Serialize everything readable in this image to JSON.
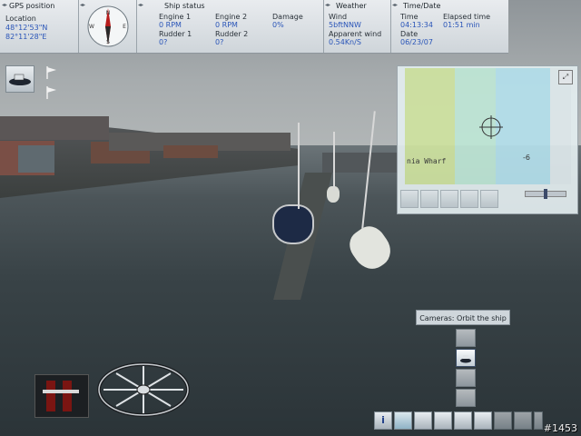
{
  "gps": {
    "title": "GPS position",
    "location_label": "Location",
    "lat": "48°12'53\"N",
    "lon": "82°11'28\"E"
  },
  "ship_status": {
    "title": "Ship status",
    "engine1_label": "Engine 1",
    "engine1_value": "0 RPM",
    "engine2_label": "Engine 2",
    "engine2_value": "0 RPM",
    "damage_label": "Damage",
    "damage_value": "0%",
    "rudder1_label": "Rudder 1",
    "rudder1_value": "0?",
    "rudder2_label": "Rudder 2",
    "rudder2_value": "0?"
  },
  "weather": {
    "title": "Weather",
    "wind_label": "Wind",
    "wind_value": "5bftNNW",
    "apparent_label": "Apparent wind",
    "apparent_value": "0.54Kn/S"
  },
  "timedate": {
    "title": "Time/Date",
    "time_label": "Time",
    "time_value": "04:13:34",
    "elapsed_label": "Elapsed time",
    "elapsed_value": "01:51 min",
    "date_label": "Date",
    "date_value": "06/23/07"
  },
  "compass": {
    "icon": "compass-icon",
    "letters": [
      "N",
      "E",
      "S",
      "W"
    ]
  },
  "minimap": {
    "location_text": "nia Wharf",
    "depth_text": "-6"
  },
  "tooltip": "Cameras: Orbit the ship",
  "watermark": "#1453",
  "toolbar_icons": [
    "info-icon",
    "chart-icon",
    "ship-icon",
    "rope-icon",
    "camera-icon",
    "photo-icon",
    "cargo-icon",
    "crate-icon",
    "settings-icon"
  ],
  "camera_modes": [
    "free-camera-icon",
    "orbit-camera-icon",
    "bridge-camera-icon",
    "deck-camera-icon"
  ]
}
